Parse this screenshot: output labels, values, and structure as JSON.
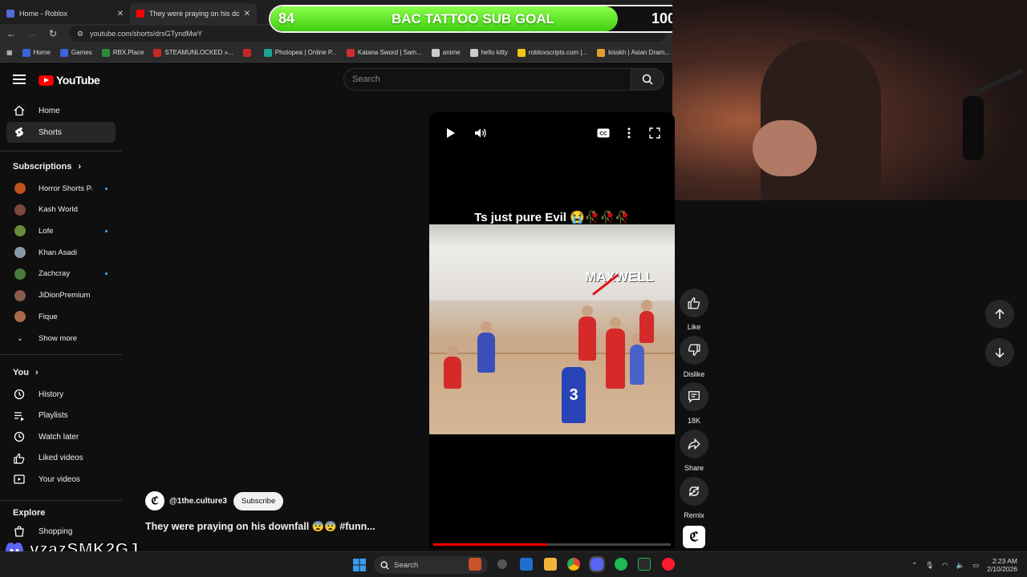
{
  "browser": {
    "tabs": [
      {
        "title": "Home - Roblox",
        "favicon_color": "#4f6bd8"
      },
      {
        "title": "They were praying on his downfall",
        "favicon_color": "#ff0000"
      }
    ],
    "url": "youtube.com/shorts/drsGTyndMwY",
    "bookmarks": [
      {
        "label": "Home",
        "color": "#3b64d6"
      },
      {
        "label": "Games",
        "color": "#3b64d6"
      },
      {
        "label": "RBX.Place",
        "color": "#2a8a3a"
      },
      {
        "label": "STEAMUNLOCKED »...",
        "color": "#c62828"
      },
      {
        "label": "",
        "color": "#c62828"
      },
      {
        "label": "Photopea | Online P...",
        "color": "#18a497"
      },
      {
        "label": "Katana Sword | Sam...",
        "color": "#d32f2f"
      },
      {
        "label": "anime",
        "color": "#cccccc"
      },
      {
        "label": "hello kitty",
        "color": "#cccccc"
      },
      {
        "label": "robloxscripts.com |...",
        "color": "#f5c518"
      },
      {
        "label": "kisskh | Asian Dram...",
        "color": "#e0a030"
      }
    ]
  },
  "overlay": {
    "sub_goal": {
      "current": "84",
      "label": "BAC TATTOO SUB GOAL",
      "target": "100",
      "progress": 0.84
    },
    "discord_name": "vzazSMK2GJ"
  },
  "youtube": {
    "logo_text": "YouTube",
    "search_placeholder": "Search",
    "nav": [
      {
        "label": "Home",
        "icon": "home-icon"
      },
      {
        "label": "Shorts",
        "icon": "shorts-icon"
      }
    ],
    "subscriptions_title": "Subscriptions",
    "subscriptions": [
      {
        "name": "Horror Shorts Pa...",
        "color": "#c0501e",
        "new": true
      },
      {
        "name": "Kash World",
        "color": "#7b4a3a",
        "new": false
      },
      {
        "name": "Lofe",
        "color": "#6b8a3a",
        "new": true
      },
      {
        "name": "Khan Asadi",
        "color": "#8899aa",
        "new": false
      },
      {
        "name": "Zachcray",
        "color": "#4a7a3a",
        "new": true
      },
      {
        "name": "JiDionPremium",
        "color": "#8a5a4a",
        "new": false
      },
      {
        "name": "Fique",
        "color": "#aa6a4a",
        "new": false
      }
    ],
    "show_more": "Show more",
    "you_title": "You",
    "you_items": [
      {
        "label": "History",
        "icon": "history-icon"
      },
      {
        "label": "Playlists",
        "icon": "playlists-icon"
      },
      {
        "label": "Watch later",
        "icon": "watch-later-icon"
      },
      {
        "label": "Liked videos",
        "icon": "liked-videos-icon"
      },
      {
        "label": "Your videos",
        "icon": "your-videos-icon"
      }
    ],
    "explore_title": "Explore",
    "explore_items": [
      {
        "label": "Shopping",
        "icon": "shopping-icon"
      }
    ],
    "short": {
      "caption": "Ts just pure Evil 😭🥀🥀🥀",
      "overlay_label": "MAXWELL",
      "jersey_number": "3",
      "channel": "@1the.culture3",
      "subscribe_label": "Subscribe",
      "title": "They were praying on his downfall 😨😨 #funn...",
      "progress": 0.48
    },
    "actions": [
      {
        "label": "Like",
        "icon": "thumbs-up-icon"
      },
      {
        "label": "Dislike",
        "icon": "thumbs-down-icon"
      },
      {
        "label": "18K",
        "icon": "comment-icon"
      },
      {
        "label": "Share",
        "icon": "share-icon"
      },
      {
        "label": "Remix",
        "icon": "remix-icon"
      }
    ]
  },
  "taskbar": {
    "search_label": "Search",
    "time": "2:23 AM",
    "date": "2/10/2026"
  }
}
